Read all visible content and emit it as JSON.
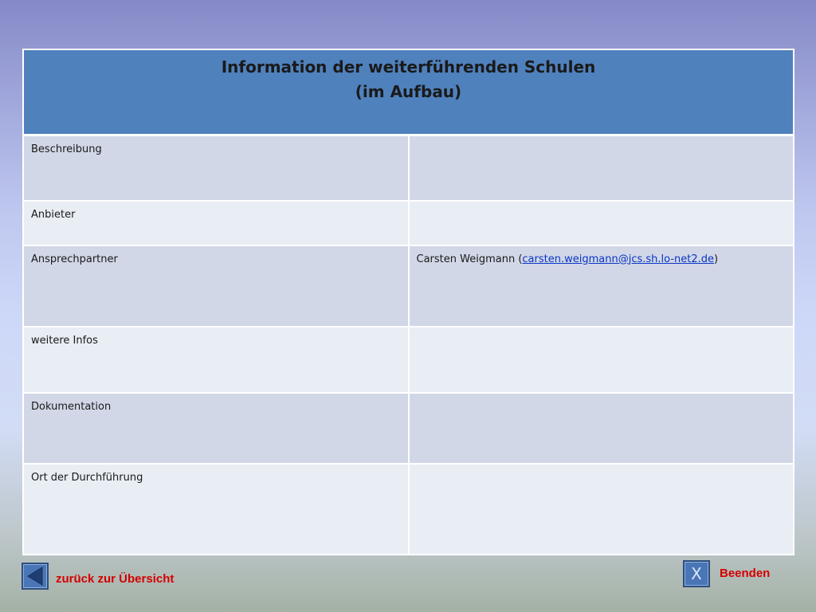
{
  "header": {
    "title_line1": "Information der weiterführenden Schulen",
    "title_line2": "(im Aufbau)"
  },
  "rows": [
    {
      "label": "Beschreibung",
      "value": ""
    },
    {
      "label": "Anbieter",
      "value": ""
    },
    {
      "label": "Ansprechpartner",
      "value_prefix": "Carsten Weigmann (",
      "email": "carsten.weigmann@jcs.sh.lo-net2.de",
      "value_suffix": ")"
    },
    {
      "label": "weitere Infos",
      "value": ""
    },
    {
      "label": "Dokumentation",
      "value": ""
    },
    {
      "label": "Ort der Durchführung",
      "value": ""
    }
  ],
  "navigation": {
    "back_label": "zurück zur Übersicht",
    "back_icon": "arrow-left-icon",
    "exit_label": "Beenden",
    "exit_icon_glyph": "X"
  },
  "colors": {
    "header_bg": "#4f81bd",
    "row_dark": "#d1d7e7",
    "row_light": "#e9edf4",
    "nav_label": "#d40000",
    "link": "#0a35c4"
  }
}
